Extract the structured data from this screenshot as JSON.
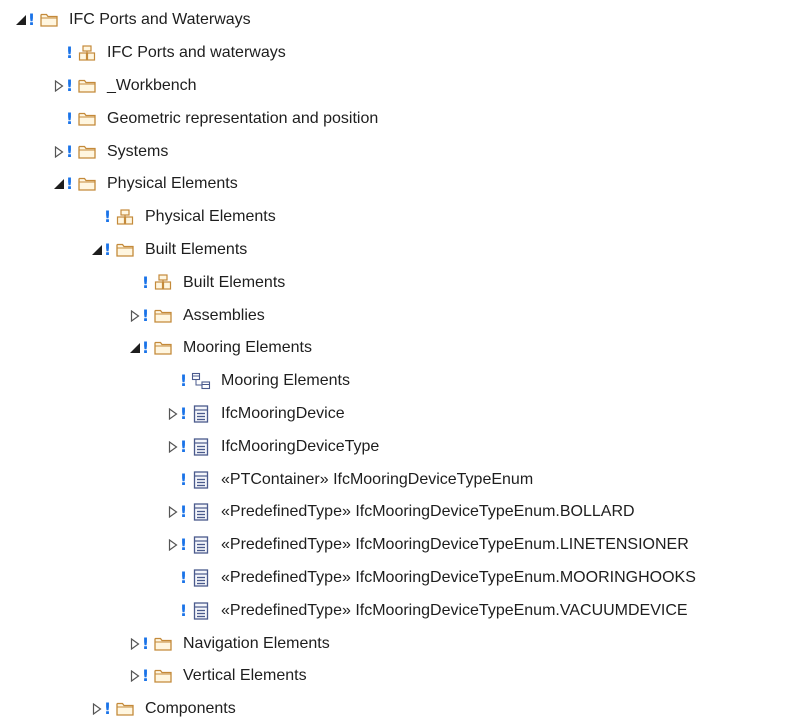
{
  "tree": {
    "rows": [
      {
        "label": "IFC Ports and Waterways",
        "indent": 0,
        "toggle": "expanded",
        "icon": "folder-icon"
      },
      {
        "label": "IFC Ports and waterways",
        "indent": 1,
        "toggle": "none",
        "icon": "package-diagram-icon"
      },
      {
        "label": "_Workbench",
        "indent": 1,
        "toggle": "collapsed",
        "icon": "folder-icon"
      },
      {
        "label": "Geometric representation and position",
        "indent": 1,
        "toggle": "none",
        "icon": "folder-icon"
      },
      {
        "label": "Systems",
        "indent": 1,
        "toggle": "collapsed",
        "icon": "folder-icon"
      },
      {
        "label": "Physical Elements",
        "indent": 1,
        "toggle": "expanded",
        "icon": "folder-icon"
      },
      {
        "label": "Physical Elements",
        "indent": 2,
        "toggle": "none",
        "icon": "package-diagram-icon"
      },
      {
        "label": "Built Elements",
        "indent": 2,
        "toggle": "expanded",
        "icon": "folder-icon"
      },
      {
        "label": "Built Elements",
        "indent": 3,
        "toggle": "none",
        "icon": "package-diagram-icon"
      },
      {
        "label": "Assemblies",
        "indent": 3,
        "toggle": "collapsed",
        "icon": "folder-icon"
      },
      {
        "label": "Mooring Elements",
        "indent": 3,
        "toggle": "expanded",
        "icon": "folder-icon"
      },
      {
        "label": "Mooring Elements",
        "indent": 4,
        "toggle": "none",
        "icon": "class-diagram-icon"
      },
      {
        "label": "IfcMooringDevice",
        "indent": 4,
        "toggle": "collapsed",
        "icon": "class-icon"
      },
      {
        "label": "IfcMooringDeviceType",
        "indent": 4,
        "toggle": "collapsed",
        "icon": "class-icon"
      },
      {
        "label": "«PTContainer» IfcMooringDeviceTypeEnum",
        "indent": 4,
        "toggle": "none",
        "icon": "class-icon"
      },
      {
        "label": "«PredefinedType» IfcMooringDeviceTypeEnum.BOLLARD",
        "indent": 4,
        "toggle": "collapsed",
        "icon": "class-icon"
      },
      {
        "label": "«PredefinedType» IfcMooringDeviceTypeEnum.LINETENSIONER",
        "indent": 4,
        "toggle": "collapsed",
        "icon": "class-icon"
      },
      {
        "label": "«PredefinedType» IfcMooringDeviceTypeEnum.MOORINGHOOKS",
        "indent": 4,
        "toggle": "none",
        "icon": "class-icon"
      },
      {
        "label": "«PredefinedType» IfcMooringDeviceTypeEnum.VACUUMDEVICE",
        "indent": 4,
        "toggle": "none",
        "icon": "class-icon"
      },
      {
        "label": "Navigation Elements",
        "indent": 3,
        "toggle": "collapsed",
        "icon": "folder-icon"
      },
      {
        "label": "Vertical Elements",
        "indent": 3,
        "toggle": "collapsed",
        "icon": "folder-icon"
      },
      {
        "label": "Components",
        "indent": 2,
        "toggle": "collapsed",
        "icon": "folder-icon"
      }
    ]
  },
  "markers": {
    "status_glyph": "!"
  },
  "colors": {
    "status_glyph": "#1a73e8",
    "folder_stroke": "#c48a3a",
    "folder_fill": "#fff6e0",
    "class_icon": "#4a5a8c",
    "text": "#1e1e1e"
  }
}
